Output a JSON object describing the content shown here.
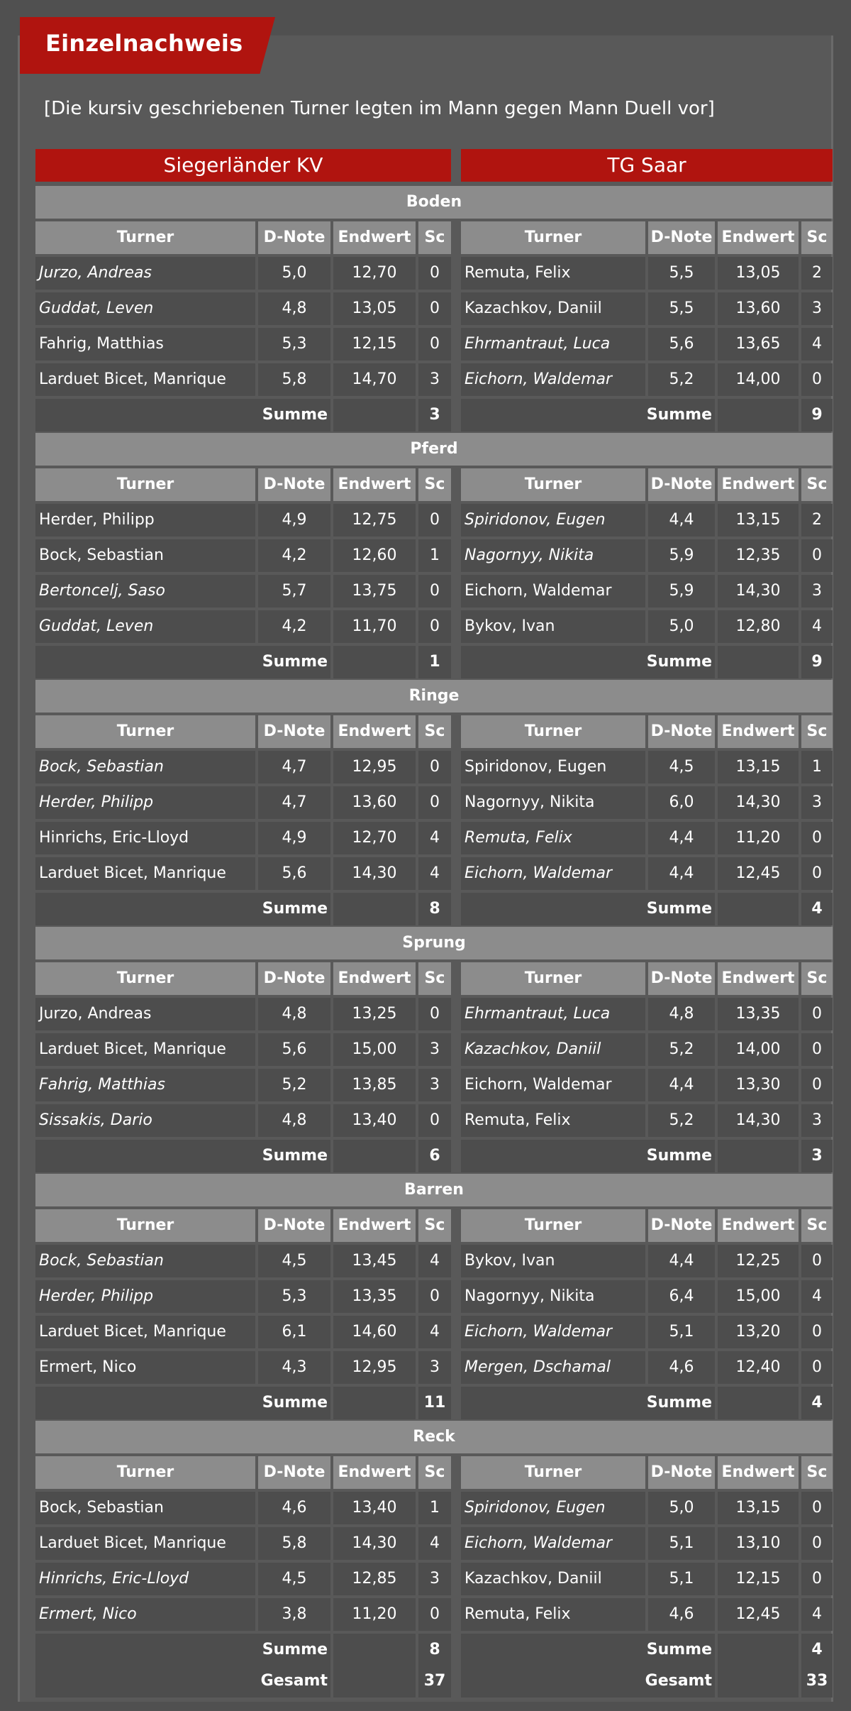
{
  "title": "Einzelnachweis",
  "note": "[Die kursiv geschriebenen Turner legten im Mann gegen Mann Duell vor]",
  "teams": {
    "left": "Siegerländer KV",
    "right": "TG Saar"
  },
  "columns": {
    "name": "Turner",
    "d": "D-Note",
    "e": "Endwert",
    "sc": "Sc"
  },
  "sum_label": "Summe",
  "total_label": "Gesamt",
  "disciplines": [
    {
      "name": "Boden",
      "left": [
        {
          "n": "Jurzo, Andreas",
          "d": "5,0",
          "e": "12,70",
          "sc": "0",
          "italic": true
        },
        {
          "n": "Guddat, Leven",
          "d": "4,8",
          "e": "13,05",
          "sc": "0",
          "italic": true
        },
        {
          "n": "Fahrig, Matthias",
          "d": "5,3",
          "e": "12,15",
          "sc": "0",
          "italic": false
        },
        {
          "n": "Larduet Bicet, Manrique",
          "d": "5,8",
          "e": "14,70",
          "sc": "3",
          "italic": false
        }
      ],
      "left_sum": "3",
      "right": [
        {
          "n": "Remuta, Felix",
          "d": "5,5",
          "e": "13,05",
          "sc": "2",
          "italic": false
        },
        {
          "n": "Kazachkov, Daniil",
          "d": "5,5",
          "e": "13,60",
          "sc": "3",
          "italic": false
        },
        {
          "n": "Ehrmantraut, Luca",
          "d": "5,6",
          "e": "13,65",
          "sc": "4",
          "italic": true
        },
        {
          "n": "Eichorn, Waldemar",
          "d": "5,2",
          "e": "14,00",
          "sc": "0",
          "italic": true
        }
      ],
      "right_sum": "9"
    },
    {
      "name": "Pferd",
      "left": [
        {
          "n": "Herder, Philipp",
          "d": "4,9",
          "e": "12,75",
          "sc": "0",
          "italic": false
        },
        {
          "n": "Bock, Sebastian",
          "d": "4,2",
          "e": "12,60",
          "sc": "1",
          "italic": false
        },
        {
          "n": "Bertoncelj, Saso",
          "d": "5,7",
          "e": "13,75",
          "sc": "0",
          "italic": true
        },
        {
          "n": "Guddat, Leven",
          "d": "4,2",
          "e": "11,70",
          "sc": "0",
          "italic": true
        }
      ],
      "left_sum": "1",
      "right": [
        {
          "n": "Spiridonov, Eugen",
          "d": "4,4",
          "e": "13,15",
          "sc": "2",
          "italic": true
        },
        {
          "n": "Nagornyy, Nikita",
          "d": "5,9",
          "e": "12,35",
          "sc": "0",
          "italic": true
        },
        {
          "n": "Eichorn, Waldemar",
          "d": "5,9",
          "e": "14,30",
          "sc": "3",
          "italic": false
        },
        {
          "n": "Bykov, Ivan",
          "d": "5,0",
          "e": "12,80",
          "sc": "4",
          "italic": false
        }
      ],
      "right_sum": "9"
    },
    {
      "name": "Ringe",
      "left": [
        {
          "n": "Bock, Sebastian",
          "d": "4,7",
          "e": "12,95",
          "sc": "0",
          "italic": true
        },
        {
          "n": "Herder, Philipp",
          "d": "4,7",
          "e": "13,60",
          "sc": "0",
          "italic": true
        },
        {
          "n": "Hinrichs, Eric-Lloyd",
          "d": "4,9",
          "e": "12,70",
          "sc": "4",
          "italic": false
        },
        {
          "n": "Larduet Bicet, Manrique",
          "d": "5,6",
          "e": "14,30",
          "sc": "4",
          "italic": false
        }
      ],
      "left_sum": "8",
      "right": [
        {
          "n": "Spiridonov, Eugen",
          "d": "4,5",
          "e": "13,15",
          "sc": "1",
          "italic": false
        },
        {
          "n": "Nagornyy, Nikita",
          "d": "6,0",
          "e": "14,30",
          "sc": "3",
          "italic": false
        },
        {
          "n": "Remuta, Felix",
          "d": "4,4",
          "e": "11,20",
          "sc": "0",
          "italic": true
        },
        {
          "n": "Eichorn, Waldemar",
          "d": "4,4",
          "e": "12,45",
          "sc": "0",
          "italic": true
        }
      ],
      "right_sum": "4"
    },
    {
      "name": "Sprung",
      "left": [
        {
          "n": "Jurzo, Andreas",
          "d": "4,8",
          "e": "13,25",
          "sc": "0",
          "italic": false
        },
        {
          "n": "Larduet Bicet, Manrique",
          "d": "5,6",
          "e": "15,00",
          "sc": "3",
          "italic": false
        },
        {
          "n": "Fahrig, Matthias",
          "d": "5,2",
          "e": "13,85",
          "sc": "3",
          "italic": true
        },
        {
          "n": "Sissakis, Dario",
          "d": "4,8",
          "e": "13,40",
          "sc": "0",
          "italic": true
        }
      ],
      "left_sum": "6",
      "right": [
        {
          "n": "Ehrmantraut, Luca",
          "d": "4,8",
          "e": "13,35",
          "sc": "0",
          "italic": true
        },
        {
          "n": "Kazachkov, Daniil",
          "d": "5,2",
          "e": "14,00",
          "sc": "0",
          "italic": true
        },
        {
          "n": "Eichorn, Waldemar",
          "d": "4,4",
          "e": "13,30",
          "sc": "0",
          "italic": false
        },
        {
          "n": "Remuta, Felix",
          "d": "5,2",
          "e": "14,30",
          "sc": "3",
          "italic": false
        }
      ],
      "right_sum": "3"
    },
    {
      "name": "Barren",
      "left": [
        {
          "n": "Bock, Sebastian",
          "d": "4,5",
          "e": "13,45",
          "sc": "4",
          "italic": true
        },
        {
          "n": "Herder, Philipp",
          "d": "5,3",
          "e": "13,35",
          "sc": "0",
          "italic": true
        },
        {
          "n": "Larduet Bicet, Manrique",
          "d": "6,1",
          "e": "14,60",
          "sc": "4",
          "italic": false
        },
        {
          "n": "Ermert, Nico",
          "d": "4,3",
          "e": "12,95",
          "sc": "3",
          "italic": false
        }
      ],
      "left_sum": "11",
      "right": [
        {
          "n": "Bykov, Ivan",
          "d": "4,4",
          "e": "12,25",
          "sc": "0",
          "italic": false
        },
        {
          "n": "Nagornyy, Nikita",
          "d": "6,4",
          "e": "15,00",
          "sc": "4",
          "italic": false
        },
        {
          "n": "Eichorn, Waldemar",
          "d": "5,1",
          "e": "13,20",
          "sc": "0",
          "italic": true
        },
        {
          "n": "Mergen, Dschamal",
          "d": "4,6",
          "e": "12,40",
          "sc": "0",
          "italic": true
        }
      ],
      "right_sum": "4"
    },
    {
      "name": "Reck",
      "left": [
        {
          "n": "Bock, Sebastian",
          "d": "4,6",
          "e": "13,40",
          "sc": "1",
          "italic": false
        },
        {
          "n": "Larduet Bicet, Manrique",
          "d": "5,8",
          "e": "14,30",
          "sc": "4",
          "italic": false
        },
        {
          "n": "Hinrichs, Eric-Lloyd",
          "d": "4,5",
          "e": "12,85",
          "sc": "3",
          "italic": true
        },
        {
          "n": "Ermert, Nico",
          "d": "3,8",
          "e": "11,20",
          "sc": "0",
          "italic": true
        }
      ],
      "left_sum": "8",
      "right": [
        {
          "n": "Spiridonov, Eugen",
          "d": "5,0",
          "e": "13,15",
          "sc": "0",
          "italic": true
        },
        {
          "n": "Eichorn, Waldemar",
          "d": "5,1",
          "e": "13,10",
          "sc": "0",
          "italic": true
        },
        {
          "n": "Kazachkov, Daniil",
          "d": "5,1",
          "e": "12,15",
          "sc": "0",
          "italic": false
        },
        {
          "n": "Remuta, Felix",
          "d": "4,6",
          "e": "12,45",
          "sc": "4",
          "italic": false
        }
      ],
      "right_sum": "4"
    }
  ],
  "totals": {
    "left": "37",
    "right": "33"
  },
  "colors": {
    "accent": "#b0140f",
    "header_gray": "#8c8c8c",
    "row_bg": "#4d4d4d",
    "page_bg": "#595959"
  }
}
